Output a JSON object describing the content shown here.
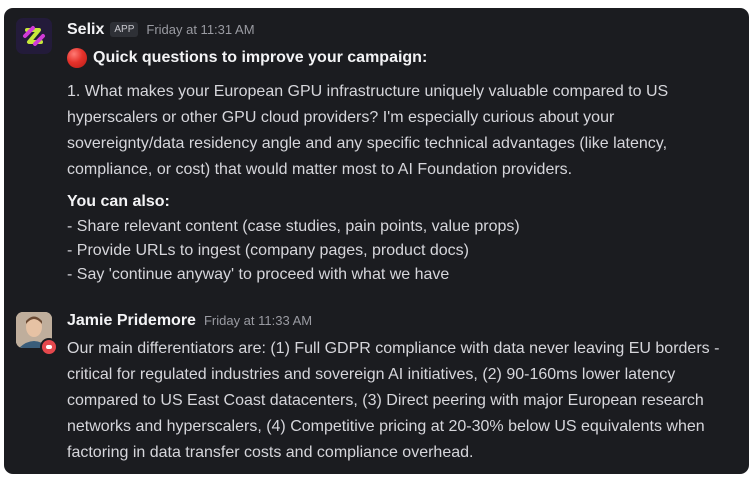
{
  "messages": [
    {
      "sender": "Selix",
      "badge": "APP",
      "time": "Friday at 11:31 AM",
      "heading": "Quick questions to improve your campaign:",
      "question": "1. What makes your European GPU infrastructure uniquely valuable compared to US hyperscalers or other GPU cloud providers? I'm especially curious about your sovereignty/data residency angle and any specific technical advantages (like latency, compliance, or cost) that would matter most to AI Foundation providers.",
      "also_title": "You can also:",
      "also_items": [
        "- Share relevant content (case studies, pain points, value props)",
        "- Provide URLs to ingest (company pages, product docs)",
        "- Say 'continue anyway' to proceed with what we have"
      ]
    },
    {
      "sender": "Jamie Pridemore",
      "time": "Friday at 11:33 AM",
      "body": "Our main differentiators are: (1) Full GDPR compliance with data never leaving EU borders - critical for regulated industries and sovereign AI initiatives, (2) 90-160ms lower latency compared to US East Coast datacenters, (3) Direct peering with major European research networks and hyperscalers, (4) Competitive pricing at 20-30% below US equivalents when factoring in data transfer costs and compliance overhead."
    }
  ],
  "colors": {
    "background": "#1b1c20",
    "text": "#d6d6db",
    "sender": "#f3f3f5",
    "timestamp": "#9a9ba2",
    "status": "#e5484d"
  }
}
